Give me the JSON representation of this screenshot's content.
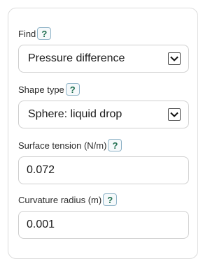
{
  "fields": {
    "find": {
      "label": "Find",
      "help": "?",
      "value": "Pressure difference"
    },
    "shape_type": {
      "label": "Shape type",
      "help": "?",
      "value": "Sphere: liquid drop"
    },
    "surface_tension": {
      "label": "Surface tension (N/m)",
      "help": "?",
      "value": "0.072"
    },
    "curvature_radius": {
      "label": "Curvature radius (m)",
      "help": "?",
      "value": "0.001"
    }
  },
  "icons": {
    "select_arrow": "chevron-down-icon",
    "help": "question-icon"
  },
  "colors": {
    "help_text": "#1f6e4f",
    "help_border": "#8fb3c7",
    "card_border": "#dcdcdc",
    "control_border": "#cfcfcf"
  }
}
